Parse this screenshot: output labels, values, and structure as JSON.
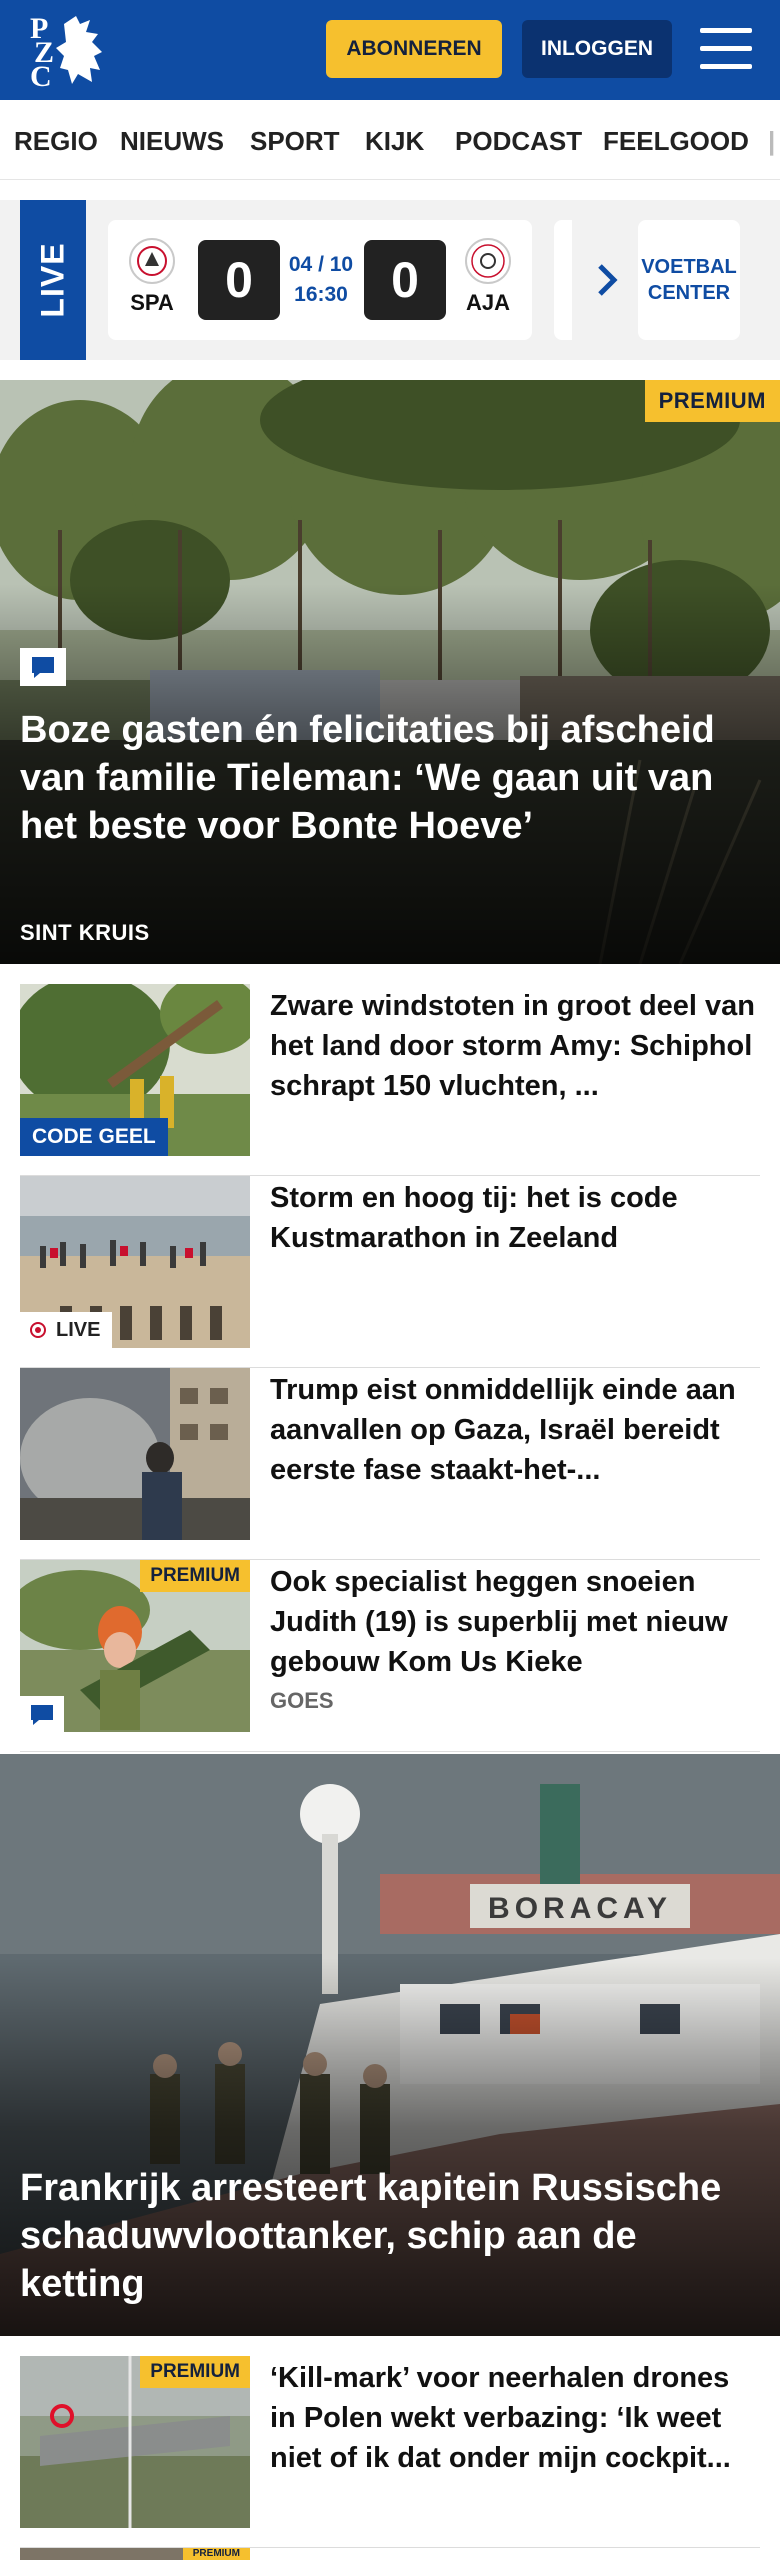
{
  "header": {
    "logo_text": "PZC",
    "subscribe_label": "ABONNEREN",
    "login_label": "INLOGGEN"
  },
  "nav": {
    "items": [
      "REGIO",
      "NIEUWS",
      "SPORT",
      "KIJK",
      "PODCAST",
      "FEELGOOD"
    ]
  },
  "live": {
    "label": "LIVE",
    "match": {
      "home": "SPA",
      "away": "AJA",
      "home_score": "0",
      "away_score": "0",
      "date": "04 / 10",
      "time": "16:30"
    },
    "voetbal_center": "VOETBAL CENTER"
  },
  "hero1": {
    "premium": "PREMIUM",
    "title": "Boze gasten én felicitaties bij afscheid van familie Tieleman: ‘We gaan uit van het beste voor Bonte Hoeve’",
    "kicker": "SINT KRUIS"
  },
  "articles": [
    {
      "title": "Zware windstoten in groot deel van het land door storm Amy: Schiphol schrapt 150 vluchten, ...",
      "tag": "CODE GEEL"
    },
    {
      "title": "Storm en hoog tij: het is code Kustmarathon in Zeeland",
      "tag": "LIVE"
    },
    {
      "title": "Trump eist onmiddellijk einde aan aanvallen op Gaza, Israël bereidt eerste fase staakt-het-...",
      "tag": ""
    },
    {
      "title": "Ook specialist heggen snoeien Judith (19) is superblij met nieuw gebouw Kom Us Kieke",
      "tag": "PREMIUM",
      "kicker": "GOES"
    }
  ],
  "hero2": {
    "title": "Frankrijk arresteert kapitein Russische schaduwvloottanker, schip aan de ketting",
    "ship_name": "BORACAY"
  },
  "articles2": [
    {
      "title": "‘Kill-mark’ voor neerhalen drones in Polen wekt verbazing: ‘Ik weet niet of ik dat onder mijn cockpit...",
      "tag": "PREMIUM"
    },
    {
      "tag": "PREMIUM"
    }
  ],
  "colors": {
    "brand_blue": "#0f4ca3",
    "accent_yellow": "#f6c02e"
  }
}
